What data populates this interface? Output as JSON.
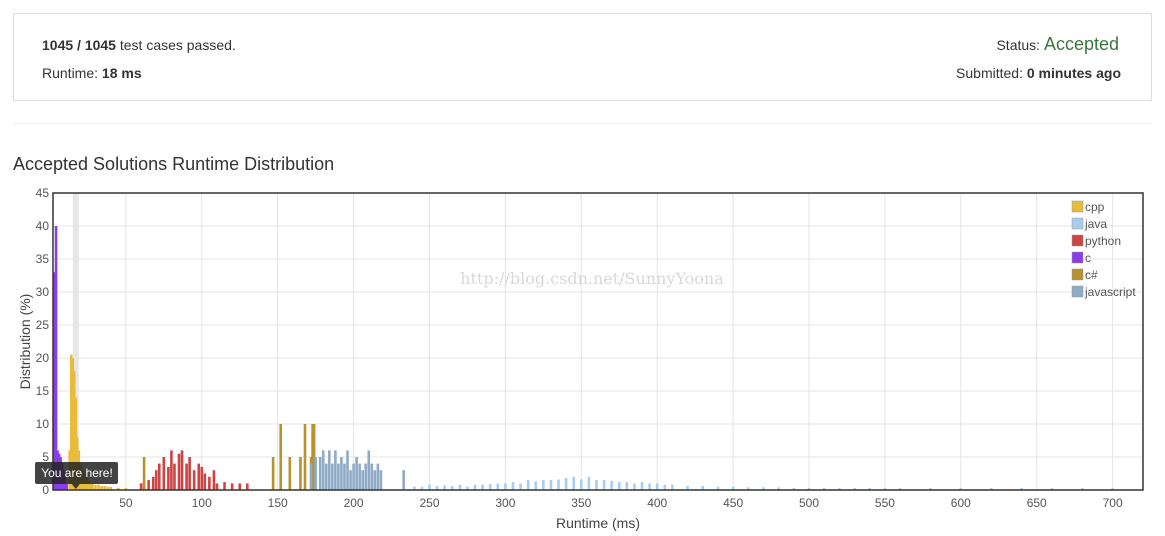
{
  "summary": {
    "passed": "1045 / 1045",
    "passed_suffix": " test cases passed.",
    "runtime_label": "Runtime: ",
    "runtime_value": "18 ms",
    "status_label": "Status: ",
    "status_value": "Accepted",
    "submitted_label": "Submitted: ",
    "submitted_value": "0 minutes ago",
    "accent_color": "#3c763d"
  },
  "section_title": "Accepted Solutions Runtime Distribution",
  "watermark": "http://blog.csdn.net/SunnyYoona",
  "tooltip": "You are here!",
  "chart_data": {
    "type": "bar",
    "xlabel": "Runtime (ms)",
    "ylabel": "Distribution (%)",
    "xlim": [
      2,
      720
    ],
    "ylim": [
      0,
      45
    ],
    "x_ticks": [
      50,
      100,
      150,
      200,
      250,
      300,
      350,
      400,
      450,
      500,
      550,
      600,
      650,
      700
    ],
    "y_ticks": [
      0,
      5,
      10,
      15,
      20,
      25,
      30,
      35,
      40,
      45
    ],
    "grid": true,
    "legend_position": "top-right",
    "marker_x": 17,
    "series": [
      {
        "name": "cpp",
        "color": "#e8bc3b",
        "x": [
          13,
          14,
          15,
          16,
          17,
          18,
          19,
          20,
          21,
          22,
          23,
          24,
          25,
          26,
          27,
          28,
          30,
          32,
          34,
          36,
          38,
          40,
          45,
          50
        ],
        "y": [
          6,
          20.5,
          20,
          18,
          14,
          8,
          6,
          4,
          3.5,
          3,
          2.5,
          2,
          1.5,
          1.2,
          1,
          1,
          0.8,
          0.8,
          0.6,
          0.6,
          0.5,
          0.5,
          0.3,
          0.3
        ]
      },
      {
        "name": "java",
        "color": "#a9cdee",
        "x": [
          240,
          245,
          250,
          255,
          260,
          265,
          270,
          275,
          280,
          285,
          290,
          295,
          300,
          305,
          310,
          315,
          320,
          325,
          330,
          335,
          340,
          345,
          350,
          355,
          360,
          365,
          370,
          375,
          380,
          385,
          390,
          395,
          400,
          405,
          410,
          420,
          430,
          440,
          450,
          460,
          470,
          480,
          490,
          500,
          510,
          520,
          530,
          540,
          550,
          560,
          580,
          600,
          620,
          640,
          660,
          680,
          700
        ],
        "y": [
          0.5,
          0.5,
          0.8,
          0.6,
          0.7,
          0.6,
          0.8,
          0.5,
          0.8,
          0.8,
          0.9,
          1,
          1,
          1.2,
          1,
          1.5,
          1.3,
          1.5,
          1.5,
          1.6,
          1.8,
          2,
          1.6,
          2,
          1.5,
          1.5,
          1.4,
          1.2,
          1.2,
          1,
          1.2,
          1,
          1,
          0.8,
          0.8,
          0.6,
          0.6,
          0.5,
          0.5,
          0.4,
          0.4,
          0.4,
          0.3,
          0.3,
          0.3,
          0.3,
          0.3,
          0.3,
          0.3,
          0.3,
          0.3,
          0.3,
          0.3,
          0.3,
          0.3,
          0.3,
          0.3
        ]
      },
      {
        "name": "python",
        "color": "#cc4444",
        "x": [
          60,
          62,
          65,
          68,
          70,
          72,
          75,
          78,
          80,
          82,
          85,
          87,
          90,
          92,
          95,
          98,
          100,
          102,
          105,
          108,
          110,
          115,
          120,
          125,
          130
        ],
        "y": [
          1,
          1.2,
          1.5,
          2,
          3,
          4,
          5,
          3.5,
          6,
          4,
          5.5,
          6,
          4,
          5,
          3,
          4,
          3.5,
          2.5,
          2,
          3,
          1,
          1.2,
          1,
          1,
          1
        ]
      },
      {
        "name": "c",
        "color": "#8a3ee8",
        "x": [
          3,
          4,
          5,
          6,
          7,
          8,
          9,
          10,
          11
        ],
        "y": [
          33,
          40,
          6,
          5.5,
          5,
          4,
          3,
          2,
          1
        ]
      },
      {
        "name": "c#",
        "color": "#b8922e",
        "x": [
          62,
          147,
          152,
          158,
          165,
          168,
          172,
          173,
          174
        ],
        "y": [
          5,
          5,
          10,
          5,
          5,
          10,
          5,
          10,
          10
        ]
      },
      {
        "name": "javascript",
        "color": "#8eaac6",
        "x": [
          172,
          175,
          178,
          180,
          182,
          184,
          186,
          188,
          190,
          192,
          194,
          196,
          198,
          200,
          202,
          204,
          206,
          208,
          210,
          212,
          214,
          216,
          218,
          233
        ],
        "y": [
          4,
          5,
          5,
          6,
          4,
          6,
          4,
          6,
          4,
          5,
          4,
          6,
          3,
          4,
          5,
          4,
          3,
          4,
          6,
          4,
          3,
          4,
          3,
          3
        ]
      }
    ]
  }
}
